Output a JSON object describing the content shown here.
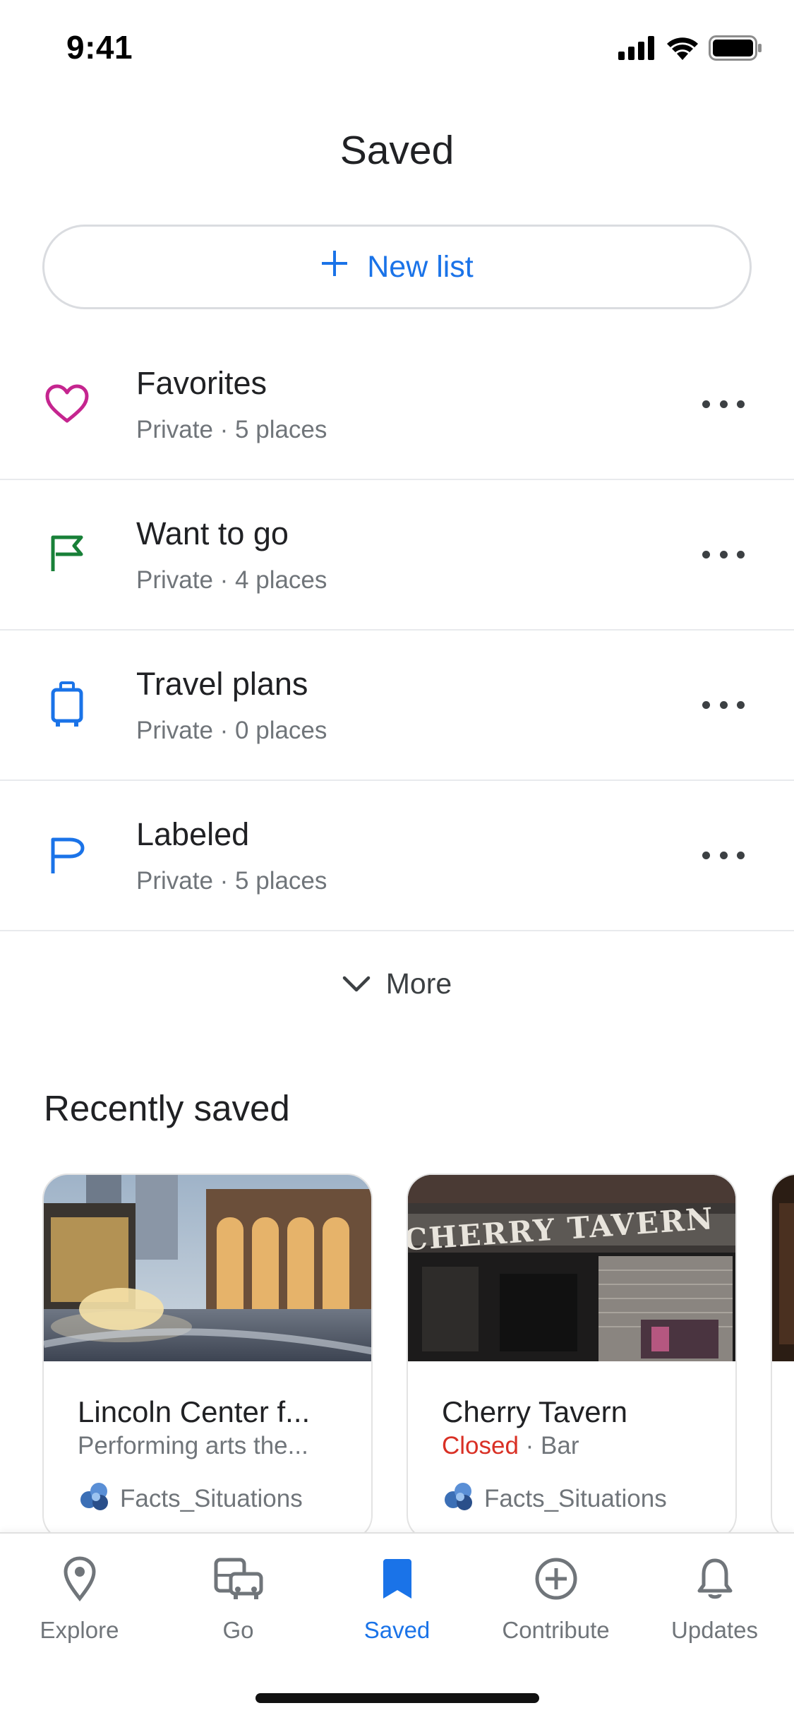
{
  "status_bar": {
    "time": "9:41",
    "icons": [
      "signal-icon",
      "wifi-icon",
      "battery-icon"
    ]
  },
  "header": {
    "title": "Saved"
  },
  "new_list": {
    "label": "New list",
    "icon": "plus-icon"
  },
  "lists": [
    {
      "title": "Favorites",
      "subtitle": "Private · 5 places",
      "icon": "heart-icon",
      "color": "#c5258f"
    },
    {
      "title": "Want to go",
      "subtitle": "Private · 4 places",
      "icon": "flag-icon",
      "color": "#188038"
    },
    {
      "title": "Travel plans",
      "subtitle": "Private · 0 places",
      "icon": "suitcase-icon",
      "color": "#1a73e8"
    },
    {
      "title": "Labeled",
      "subtitle": "Private · 5 places",
      "icon": "label-flag-icon",
      "color": "#1a73e8"
    }
  ],
  "more": {
    "label": "More"
  },
  "recently_saved": {
    "title": "Recently saved",
    "cards": [
      {
        "title": "Lincoln Center f...",
        "subtitle": "Performing arts the...",
        "status": "",
        "author": "Facts_Situations"
      },
      {
        "title": "Cherry Tavern",
        "status": "Closed",
        "subtitle": " · Bar",
        "author": "Facts_Situations",
        "sign_text": "CHERRY TAVERN"
      }
    ]
  },
  "bottom_nav": {
    "items": [
      {
        "label": "Explore",
        "icon": "location-pin-icon",
        "active": false
      },
      {
        "label": "Go",
        "icon": "commute-icon",
        "active": false
      },
      {
        "label": "Saved",
        "icon": "bookmark-icon",
        "active": true
      },
      {
        "label": "Contribute",
        "icon": "add-circle-icon",
        "active": false
      },
      {
        "label": "Updates",
        "icon": "bell-icon",
        "active": false
      }
    ]
  },
  "colors": {
    "accent": "#1a73e8",
    "closed": "#d93025",
    "secondary_text": "#70757a"
  }
}
